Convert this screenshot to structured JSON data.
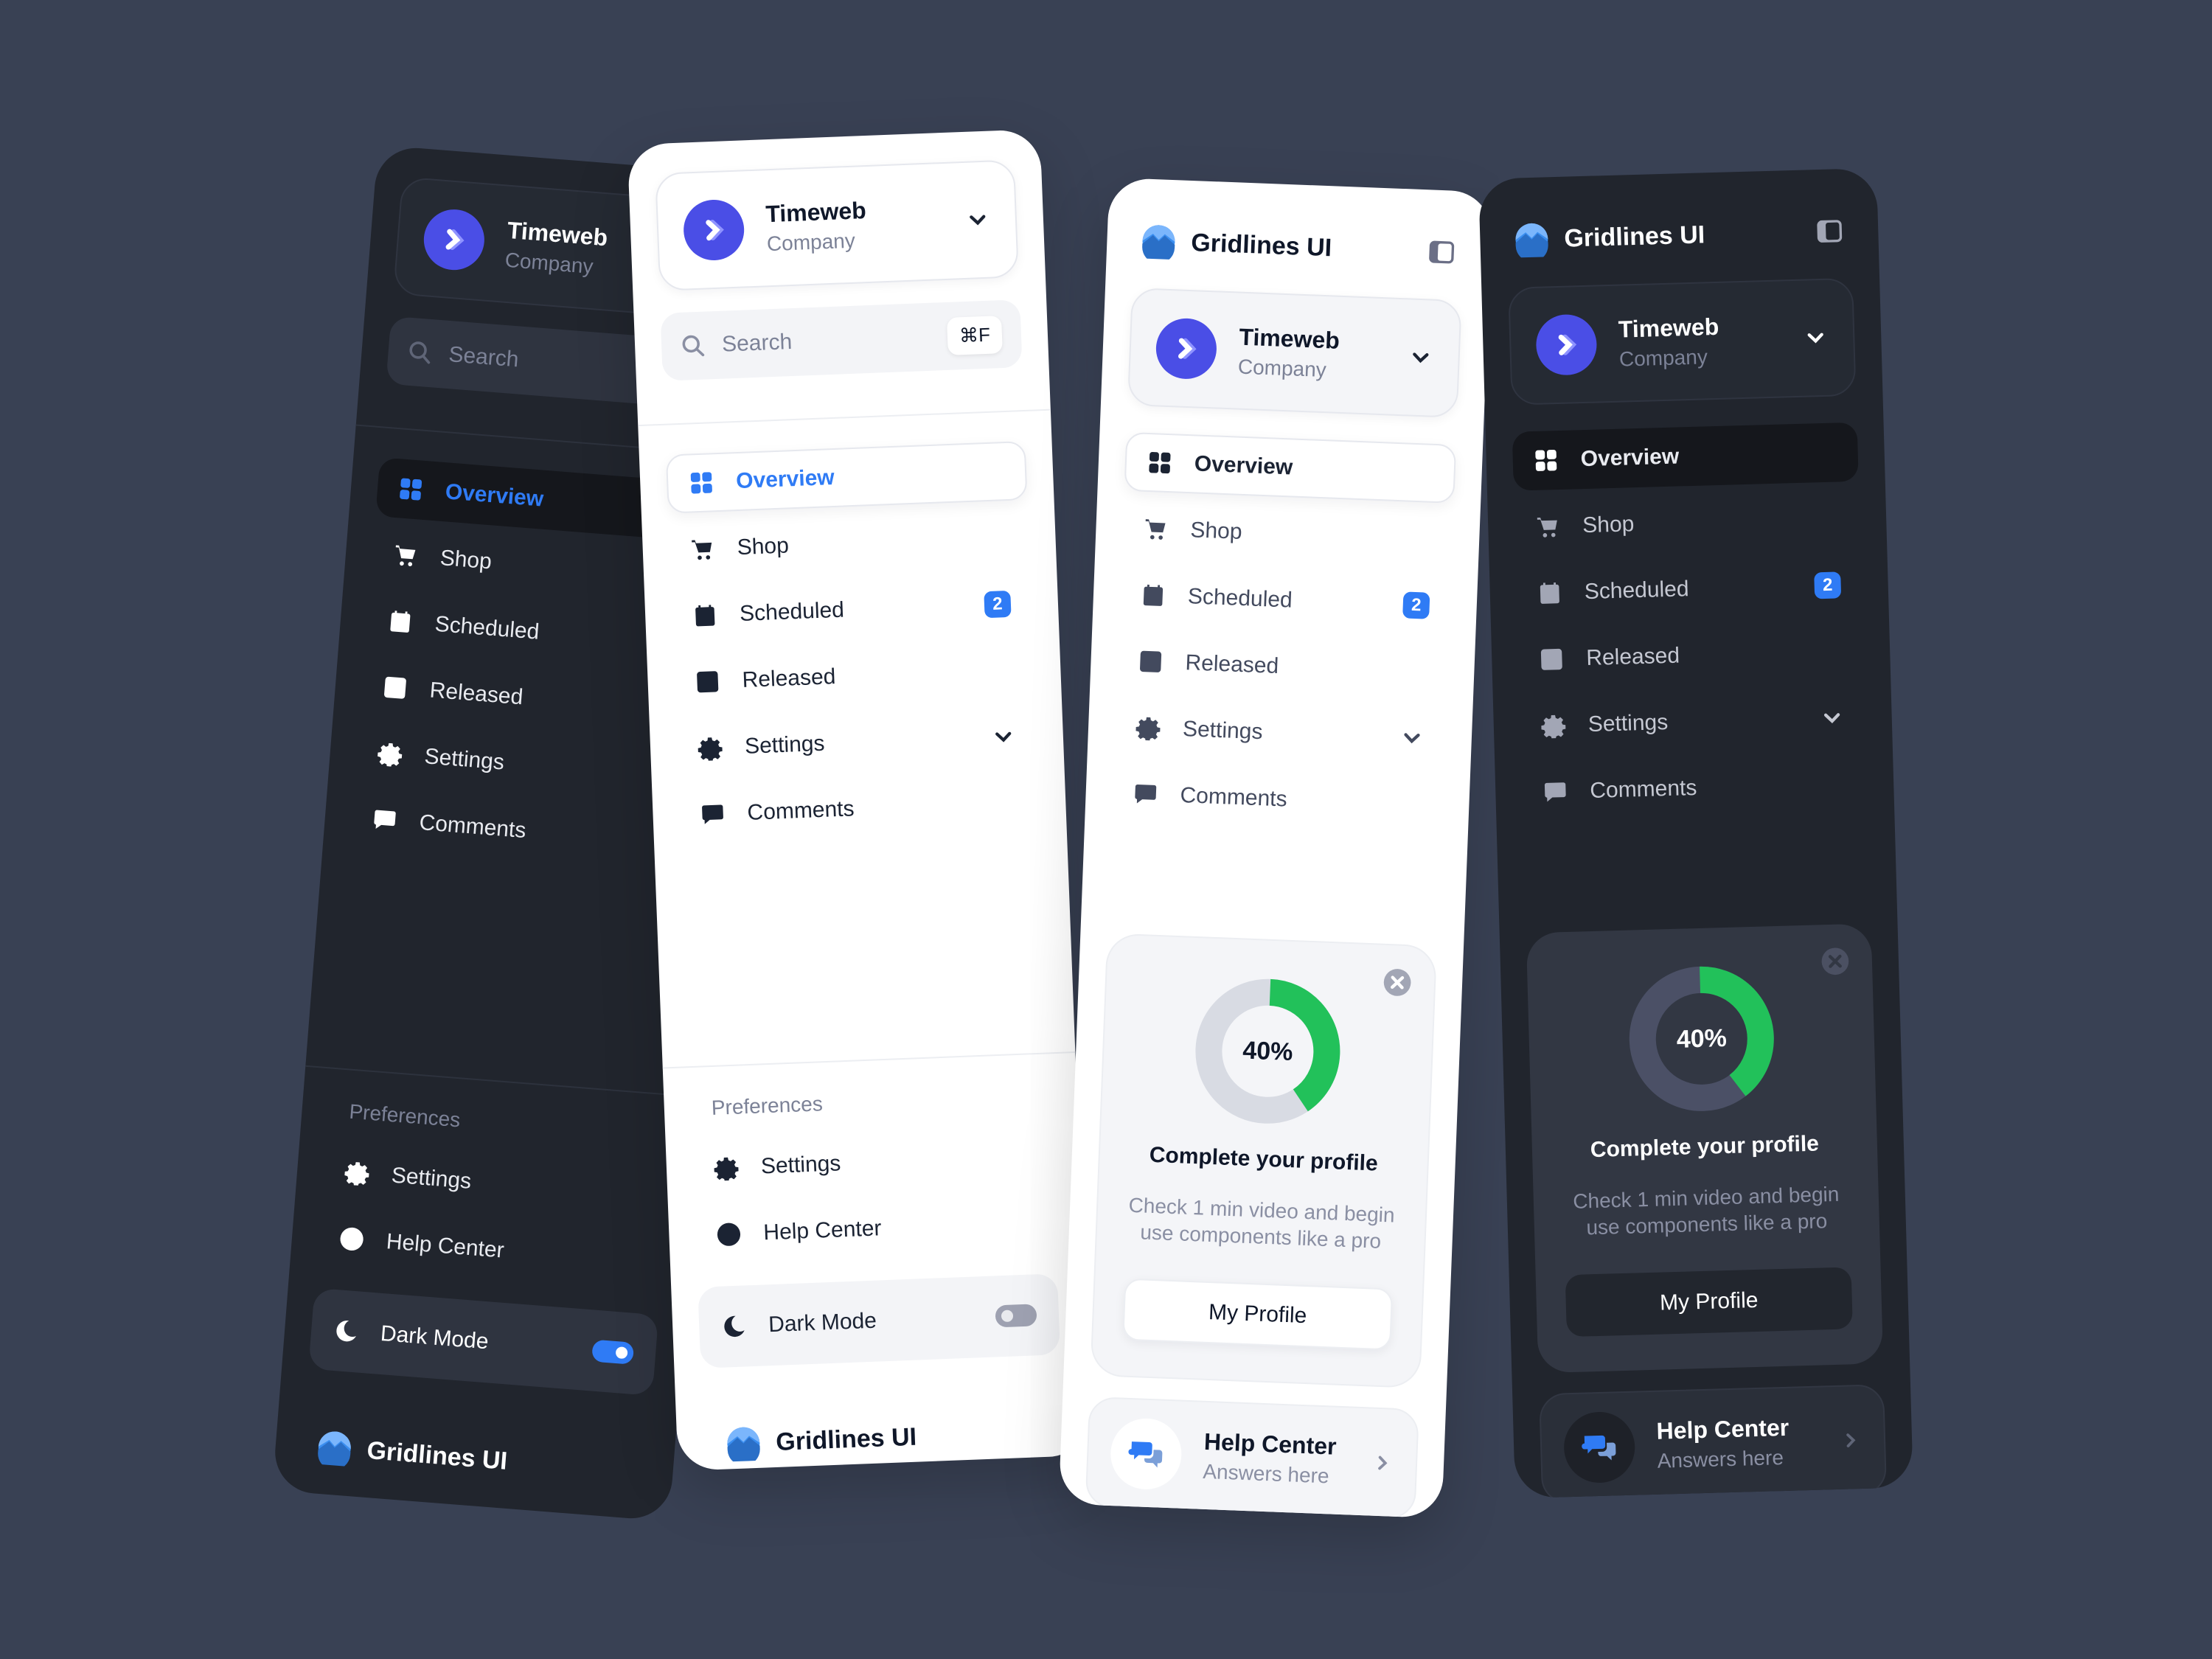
{
  "colors": {
    "background": "#394154",
    "dark_card": "#21252d",
    "accent_blue": "#2f7bf5",
    "avatar_purple": "#4a4ee6",
    "progress_green": "#22c15a"
  },
  "account": {
    "name": "Timeweb",
    "subtitle": "Company"
  },
  "brand": {
    "name": "Gridlines UI"
  },
  "search": {
    "placeholder": "Search",
    "shortcut": "⌘F"
  },
  "nav": {
    "items": [
      {
        "label": "Overview",
        "icon": "grid-icon",
        "active": true
      },
      {
        "label": "Shop",
        "icon": "cart-icon"
      },
      {
        "label": "Scheduled",
        "icon": "calendar-icon",
        "badge": "2"
      },
      {
        "label": "Released",
        "icon": "list-icon"
      },
      {
        "label": "Settings",
        "icon": "gear-icon",
        "expandable": true
      },
      {
        "label": "Comments",
        "icon": "comment-icon"
      }
    ]
  },
  "preferences": {
    "title": "Preferences",
    "items": [
      {
        "label": "Settings",
        "icon": "gear-icon"
      },
      {
        "label": "Help Center",
        "icon": "question-icon"
      }
    ],
    "dark_mode": {
      "label": "Dark Mode",
      "icon": "moon-icon"
    },
    "dark_mode_on_card1": true,
    "dark_mode_on_card2": false
  },
  "profile_widget": {
    "progress_percent": 40,
    "progress_label": "40%",
    "title": "Complete your profile",
    "description": "Check 1 min video and begin use components like a pro",
    "button_label": "My Profile"
  },
  "help_widget": {
    "title": "Help Center",
    "subtitle": "Answers here"
  }
}
